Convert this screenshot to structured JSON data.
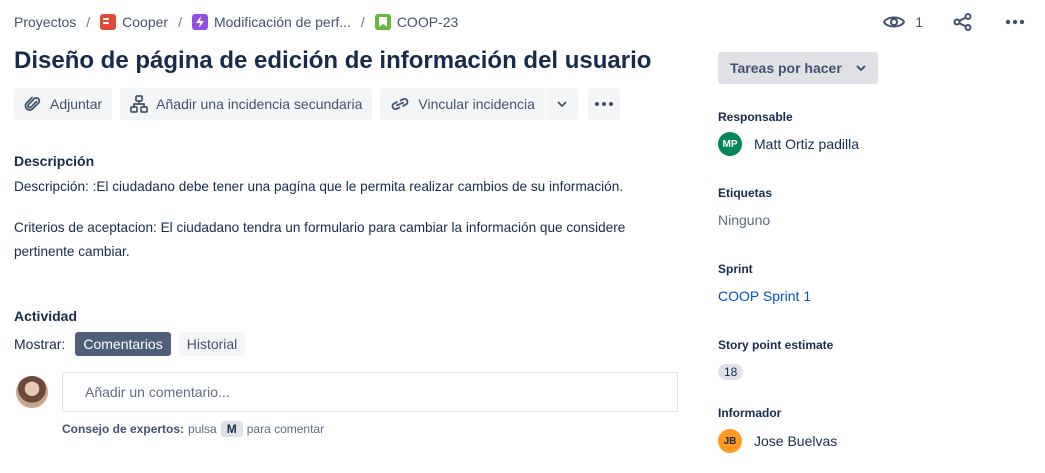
{
  "breadcrumb": {
    "projects": "Proyectos",
    "project": "Cooper",
    "epic": "Modificación de perf...",
    "issue": "COOP-23",
    "separator": "/"
  },
  "header": {
    "watchers": "1"
  },
  "issue": {
    "title": "Diseño de página de edición de información del usuario"
  },
  "toolbar": {
    "attach": "Adjuntar",
    "add_child": "Añadir una incidencia secundaria",
    "link_issue": "Vincular incidencia"
  },
  "description": {
    "heading": "Descripción",
    "line1": "Descripción: :El ciudadano debe tener una pagína que le permita  realizar cambios de su información.",
    "line2": "Criterios de aceptacion: El ciudadano tendra un formulario para cambiar la información que considere pertinente cambiar."
  },
  "activity": {
    "heading": "Actividad",
    "show_label": "Mostrar:",
    "tabs": [
      "Comentarios",
      "Historial"
    ],
    "comment_placeholder": "Añadir un comentario...",
    "tip_label": "Consejo de expertos:",
    "tip_press": "pulsa",
    "tip_key": "M",
    "tip_action": "para comentar"
  },
  "sidebar": {
    "status": "Tareas por hacer",
    "assignee_label": "Responsable",
    "assignee_initials": "MP",
    "assignee_name": "Matt Ortiz padilla",
    "labels_label": "Etiquetas",
    "labels_value": "Ninguno",
    "sprint_label": "Sprint",
    "sprint_value": "COOP Sprint 1",
    "story_points_label": "Story point estimate",
    "story_points_value": "18",
    "reporter_label": "Informador",
    "reporter_initials": "JB",
    "reporter_name": "Jose Buelvas"
  },
  "colors": {
    "accent": "#0052cc",
    "assignee_avatar": "#00875a",
    "reporter_avatar": "#ff991f",
    "active_tab": "#505f79"
  }
}
